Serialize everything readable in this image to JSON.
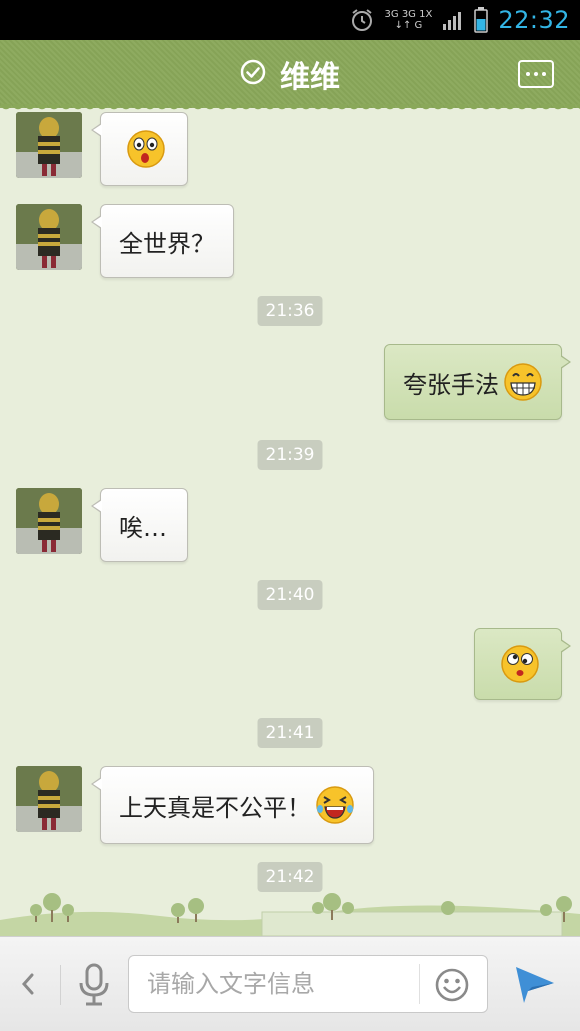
{
  "status_bar": {
    "network_top": "3G 3G 1X",
    "network_bottom": "↓↑  G",
    "time": "22:32"
  },
  "header": {
    "title": "维维",
    "status_icon": "check-circle-icon",
    "more_icon": "more-dots-icon"
  },
  "messages": [
    {
      "side": "left",
      "type": "emoji",
      "emoji": "surprised-face"
    },
    {
      "side": "left",
      "type": "text",
      "text": "全世界？"
    },
    {
      "type": "time",
      "text": "21:36"
    },
    {
      "side": "right",
      "type": "text",
      "text": "夸张手法",
      "emoji": "grinning-face"
    },
    {
      "type": "time",
      "text": "21:39"
    },
    {
      "side": "left",
      "type": "text",
      "text": "唉…"
    },
    {
      "type": "time",
      "text": "21:40"
    },
    {
      "side": "right",
      "type": "emoji",
      "emoji": "dizzy-face"
    },
    {
      "type": "time",
      "text": "21:41"
    },
    {
      "side": "left",
      "type": "text",
      "text": "上天真是不公平！",
      "emoji": "laughing-tears-face"
    },
    {
      "type": "time",
      "text": "21:42"
    }
  ],
  "input_bar": {
    "placeholder": "请输入文字信息",
    "back_icon": "chevron-left-icon",
    "mic_icon": "microphone-icon",
    "emoji_icon": "smiley-icon",
    "send_icon": "send-icon"
  },
  "colors": {
    "header": "#8aa85a",
    "chat_background": "#e8eedb",
    "clock": "#33b5e5",
    "bubble_right": "#d1e1b6",
    "timestamp_bg": "#c8cdbf"
  }
}
